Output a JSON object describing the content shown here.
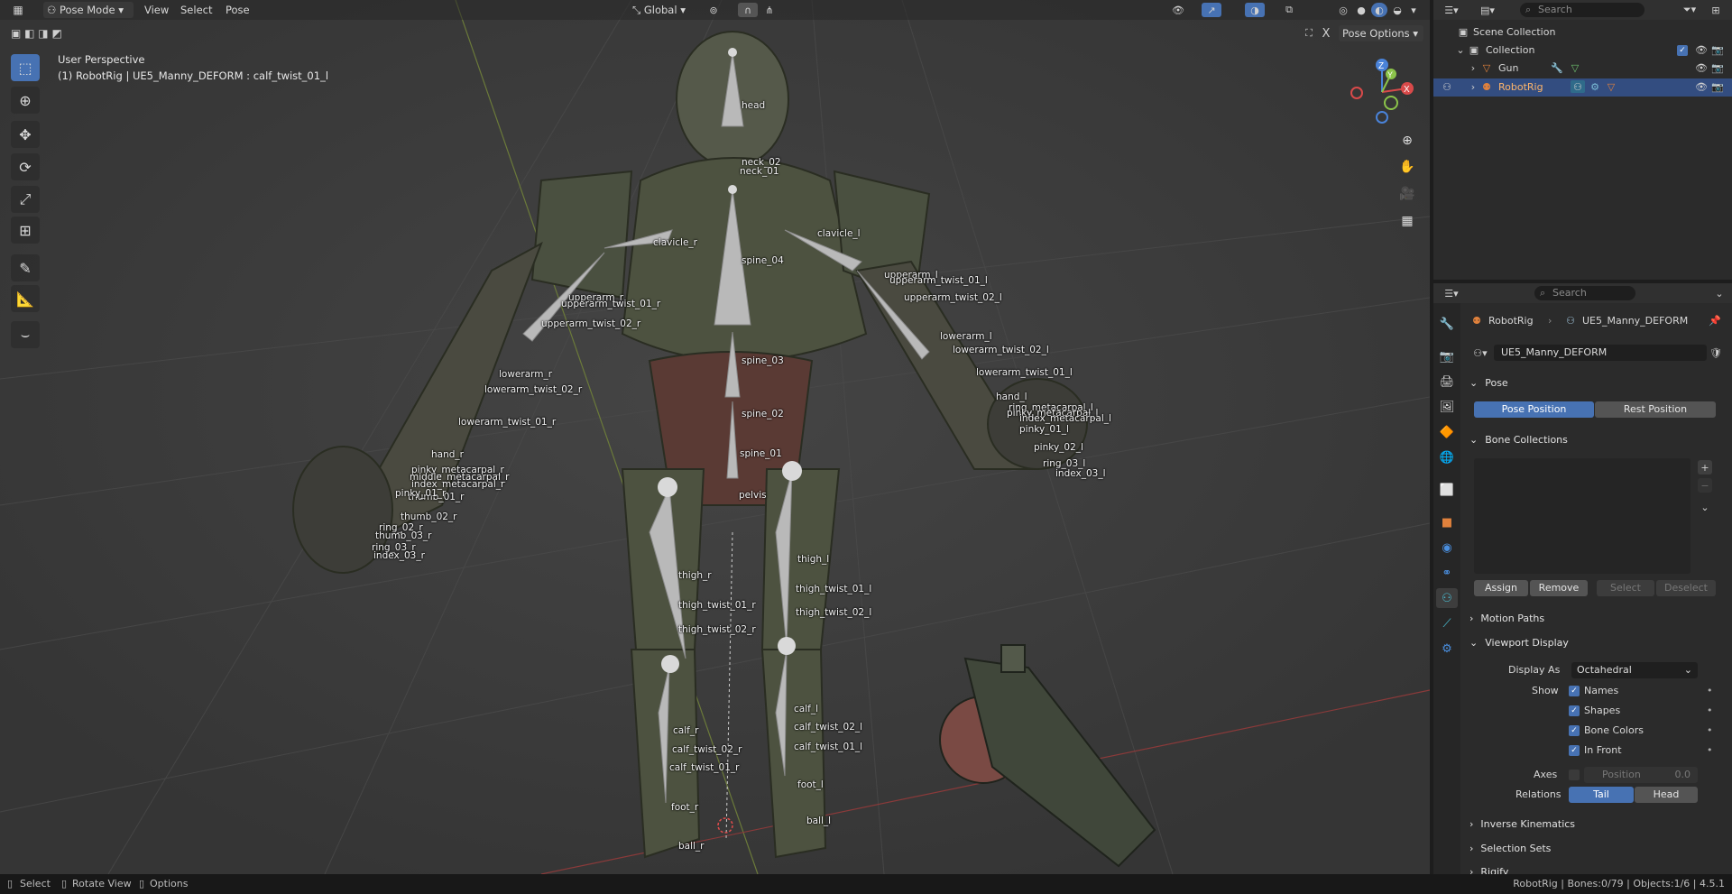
{
  "header": {
    "mode": "Pose Mode",
    "menus": [
      "View",
      "Select",
      "Pose"
    ],
    "orientation": "Global",
    "pose_options": "Pose Options"
  },
  "viewport": {
    "perspective": "User Perspective",
    "context": "(1) RobotRig | UE5_Manny_DEFORM : calf_twist_01_l"
  },
  "bones": [
    "head",
    "neck_02",
    "neck_01",
    "clavicle_r",
    "clavicle_l",
    "spine_04",
    "upperarm_l",
    "upperarm_twist_01_l",
    "upperarm_twist_02_l",
    "upperarm_r",
    "upperarm_twist_01_r",
    "upperarm_twist_02_r",
    "lowerarm_l",
    "lowerarm_twist_02_l",
    "lowerarm_twist_01_l",
    "spine_03",
    "lowerarm_r",
    "lowerarm_twist_02_r",
    "hand_l",
    "ring_metacarpal_l",
    "pinky_metacarpal_l",
    "index_metacarpal_l",
    "pinky_01_l",
    "pinky_02_l",
    "ring_03_l",
    "index_03_l",
    "spine_02",
    "lowerarm_twist_01_r",
    "hand_r",
    "pinky_metacarpal_r",
    "middle_metacarpal_r",
    "index_metacarpal_r",
    "spine_01",
    "thumb_01_r",
    "pinky_01_r",
    "thumb_02_r",
    "ring_02_r",
    "thumb_03_r",
    "ring_03_r",
    "index_03_r",
    "pelvis",
    "thigh_l",
    "thigh_r",
    "thigh_twist_01_l",
    "thigh_twist_01_r",
    "thigh_twist_02_l",
    "thigh_twist_02_r",
    "calf_l",
    "calf_twist_02_l",
    "calf_r",
    "calf_twist_01_l",
    "calf_twist_02_r",
    "calf_twist_01_r",
    "foot_l",
    "foot_r",
    "ball_l",
    "ball_r"
  ],
  "outliner": {
    "search_placeholder": "Search",
    "scene_collection": "Scene Collection",
    "collection": "Collection",
    "items": [
      "Gun",
      "RobotRig"
    ]
  },
  "properties": {
    "search_placeholder": "Search",
    "breadcrumb": [
      "RobotRig",
      "UE5_Manny_DEFORM"
    ],
    "armature_name": "UE5_Manny_DEFORM",
    "pose_panel": "Pose",
    "pose_position": "Pose Position",
    "rest_position": "Rest Position",
    "bone_collections": "Bone Collections",
    "assign": "Assign",
    "remove": "Remove",
    "select": "Select",
    "deselect": "Deselect",
    "motion_paths": "Motion Paths",
    "viewport_display": "Viewport Display",
    "display_as_label": "Display As",
    "display_as": "Octahedral",
    "show_label": "Show",
    "names": "Names",
    "shapes": "Shapes",
    "bone_colors": "Bone Colors",
    "in_front": "In Front",
    "axes_label": "Axes",
    "position_label": "Position",
    "position_value": "0.0",
    "relations_label": "Relations",
    "tail": "Tail",
    "head": "Head",
    "inverse_kinematics": "Inverse Kinematics",
    "selection_sets": "Selection Sets",
    "rigify": "Rigify"
  },
  "status": {
    "select": "Select",
    "rotate": "Rotate View",
    "options": "Options",
    "right": "RobotRig | Bones:0/79 | Objects:1/6 | 4.5.1"
  },
  "colors": {
    "accent": "#4772b3",
    "selected_row": "#334d80",
    "rig_orange": "#e0813c"
  }
}
